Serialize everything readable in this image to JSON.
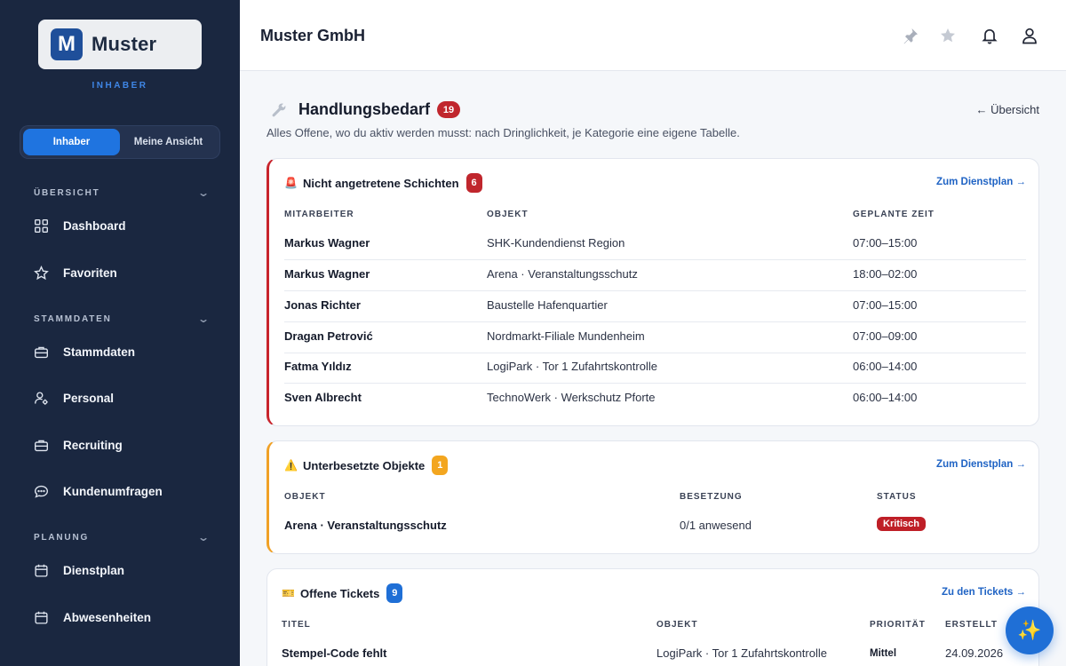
{
  "brand": {
    "initial": "M",
    "name": "Muster",
    "role": "INHABER"
  },
  "view_toggle": {
    "active": "Inhaber",
    "other": "Meine Ansicht"
  },
  "nav": {
    "sections": [
      {
        "label": "ÜBERSICHT",
        "items": [
          "Dashboard",
          "Favoriten"
        ]
      },
      {
        "label": "STAMMDATEN",
        "items": [
          "Stammdaten",
          "Personal",
          "Recruiting",
          "Kundenumfragen"
        ]
      },
      {
        "label": "PLANUNG",
        "items": [
          "Dienstplan",
          "Abwesenheiten"
        ]
      }
    ]
  },
  "header": {
    "company": "Muster GmbH",
    "icons": [
      "pin-icon",
      "star-icon",
      "bell-icon",
      "user-icon"
    ]
  },
  "page": {
    "title": "Handlungsbedarf",
    "count": "19",
    "subtitle": "Alles Offene, wo du aktiv werden musst: nach Dringlichkeit, je Kategorie eine eigene Tabelle.",
    "back_link": "← Übersicht"
  },
  "cards": {
    "shifts": {
      "emoji": "🚨",
      "title": "Nicht angetretene Schichten",
      "count": "6",
      "link": "Zum Dienstplan →",
      "columns": [
        "MITARBEITER",
        "OBJEKT",
        "GEPLANTE ZEIT"
      ],
      "rows": [
        [
          "Markus Wagner",
          "SHK-Kundendienst Region",
          "07:00–15:00"
        ],
        [
          "Markus Wagner",
          "Arena · Veranstaltungsschutz",
          "18:00–02:00"
        ],
        [
          "Jonas Richter",
          "Baustelle Hafenquartier",
          "07:00–15:00"
        ],
        [
          "Dragan Petrović",
          "Nordmarkt-Filiale Mundenheim",
          "07:00–09:00"
        ],
        [
          "Fatma Yıldız",
          "LogiPark · Tor 1 Zufahrtskontrolle",
          "06:00–14:00"
        ],
        [
          "Sven Albrecht",
          "TechnoWerk · Werkschutz Pforte",
          "06:00–14:00"
        ]
      ]
    },
    "understaffed": {
      "emoji": "⚠️",
      "title": "Unterbesetzte Objekte",
      "count": "1",
      "link": "Zum Dienstplan →",
      "columns": [
        "OBJEKT",
        "BESETZUNG",
        "STATUS"
      ],
      "rows": [
        [
          "Arena · Veranstaltungsschutz",
          "0/1 anwesend",
          "Kritisch"
        ]
      ]
    },
    "tickets": {
      "emoji": "🎫",
      "title": "Offene Tickets",
      "count": "9",
      "link": "Zu den Tickets →",
      "columns": [
        "TITEL",
        "OBJEKT",
        "PRIORITÄT",
        "ERSTELLT"
      ],
      "rows": [
        [
          "Stempel-Code fehlt",
          "LogiPark · Tor 1 Zufahrtskontrolle",
          "Mittel",
          "24.09.2026"
        ]
      ]
    }
  },
  "fab": {
    "icon": "sparkles-icon"
  },
  "colors": {
    "sidebar": "#1a2740",
    "accent": "#1f74e0",
    "danger": "#c0262d",
    "warning": "#f3a61f"
  }
}
